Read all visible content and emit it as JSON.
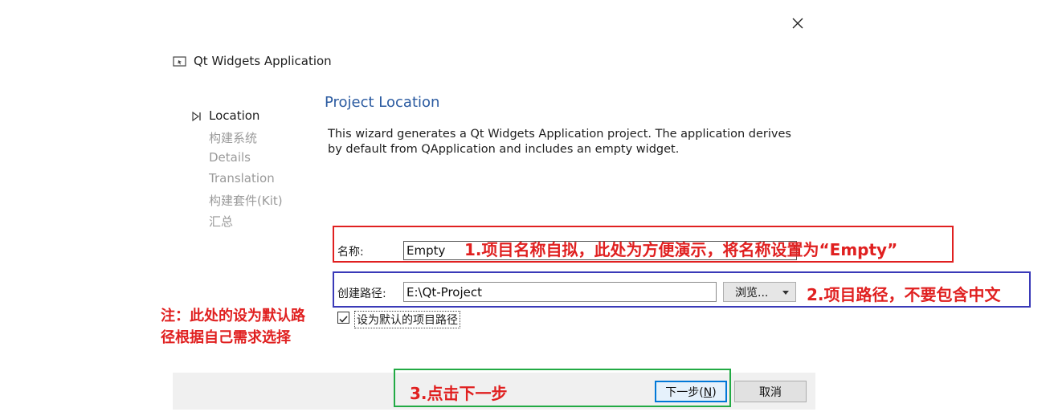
{
  "window": {
    "title": "Qt Widgets Application",
    "close_icon": "close-icon"
  },
  "steps": [
    {
      "label": "Location",
      "current": true
    },
    {
      "label": "构建系统",
      "current": false
    },
    {
      "label": "Details",
      "current": false
    },
    {
      "label": "Translation",
      "current": false
    },
    {
      "label": "构建套件(Kit)",
      "current": false
    },
    {
      "label": "汇总",
      "current": false
    }
  ],
  "main": {
    "title": "Project Location",
    "description_line1": "This wizard generates a Qt Widgets Application project. The application derives",
    "description_line2": "by default from QApplication and includes an empty widget."
  },
  "form": {
    "name_label": "名称:",
    "name_value": "Empty",
    "path_label": "创建路径:",
    "path_value": "E:\\Qt-Project",
    "browse_label": "浏览...",
    "default_checkbox_label": "设为默认的项目路径",
    "default_checked": true
  },
  "buttons": {
    "next_label": "下一步(N)",
    "next_mnemonic": "N",
    "cancel_label": "取消"
  },
  "annotations": {
    "note1": "1.项目名称自拟，此处为方便演示，将名称设置为“Empty”",
    "note2": "2.项目路径，不要包含中文",
    "note3": "3.点击下一步",
    "side_note_line1": "注：此处的设为默认路",
    "side_note_line2": "径根据自己需求选择"
  },
  "colors": {
    "accent": "#2a5aa0",
    "annotation_red": "#e02020",
    "annotation_blue": "#3a3ab8",
    "annotation_green": "#22aa44",
    "focus_blue": "#0078d7"
  }
}
